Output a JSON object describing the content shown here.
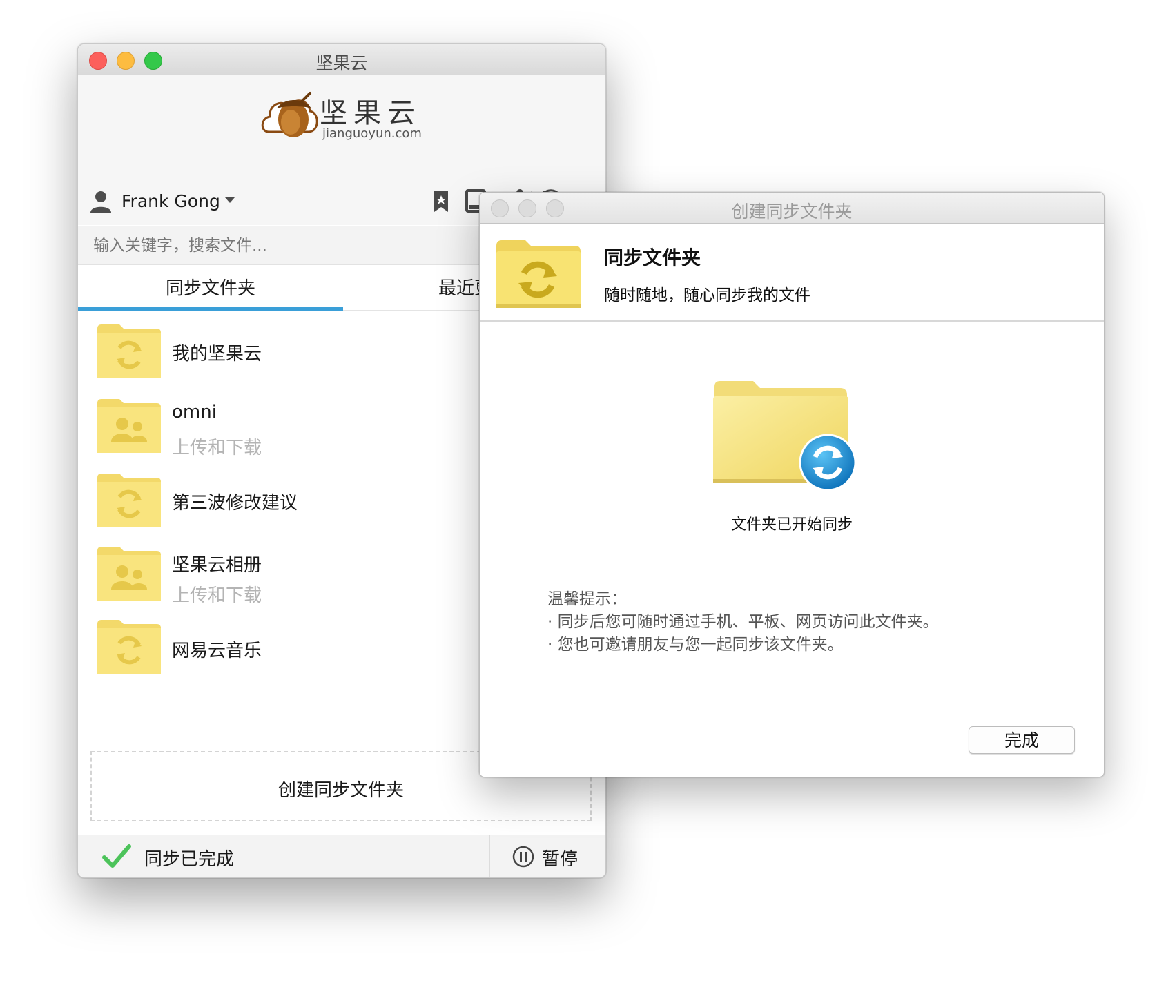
{
  "main_window": {
    "title": "坚果云",
    "logo": {
      "name_cn": "坚果云",
      "domain": "jianguoyun.com"
    },
    "user": {
      "name": "Frank Gong"
    },
    "toolbar_icons": [
      "bookmark-icon",
      "tablet-icon",
      "share-icon",
      "history-icon"
    ],
    "search": {
      "placeholder": "输入关键字，搜索文件..."
    },
    "tabs": [
      {
        "label": "同步文件夹",
        "active": true
      },
      {
        "label": "最近更新",
        "active": false
      }
    ],
    "folders": [
      {
        "name": "我的坚果云",
        "subtitle": "",
        "icon": "sync-folder-icon"
      },
      {
        "name": "omni",
        "subtitle": "上传和下载",
        "icon": "shared-folder-icon"
      },
      {
        "name": "第三波修改建议",
        "subtitle": "",
        "icon": "sync-folder-icon"
      },
      {
        "name": "坚果云相册",
        "subtitle": "上传和下载",
        "icon": "shared-folder-icon"
      },
      {
        "name": "网易云音乐",
        "subtitle": "",
        "icon": "sync-folder-icon"
      }
    ],
    "create_button": "创建同步文件夹",
    "status": {
      "text": "同步已完成",
      "pause_label": "暂停"
    }
  },
  "dialog": {
    "title": "创建同步文件夹",
    "heading": "同步文件夹",
    "subheading": "随时随地，随心同步我的文件",
    "message": "文件夹已开始同步",
    "tips_title": "温馨提示：",
    "tips": [
      "· 同步后您可随时通过手机、平板、网页访问此文件夹。",
      "· 您也可邀请朋友与您一起同步该文件夹。"
    ],
    "done_button": "完成"
  },
  "colors": {
    "accent_blue": "#3a9fd8",
    "folder_yellow": "#f9e27a",
    "check_green": "#4cc35a",
    "traffic_red": "#fc605c",
    "traffic_yellow": "#fdbc40",
    "traffic_green": "#34c84a"
  }
}
